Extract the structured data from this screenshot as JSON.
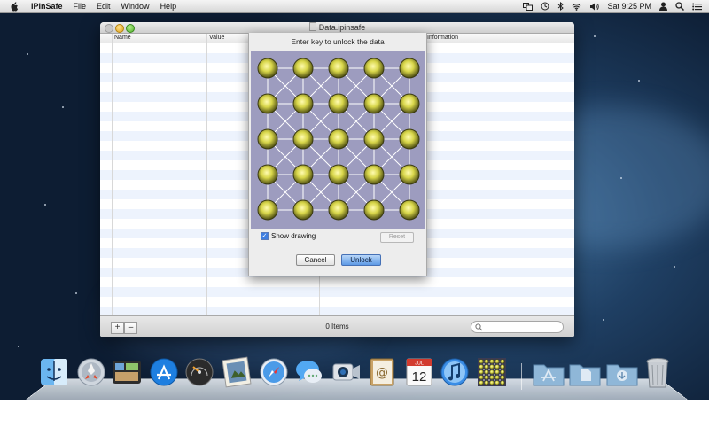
{
  "menubar": {
    "app_name": "iPinSafe",
    "menus": [
      "File",
      "Edit",
      "Window",
      "Help"
    ],
    "clock": "Sat 9:25 PM"
  },
  "window": {
    "title": "Data.ipinsafe",
    "columns": [
      "Name",
      "Value",
      "Information"
    ],
    "items_count": "0 Items",
    "add_label": "+",
    "remove_label": "–"
  },
  "sheet": {
    "title": "Enter key to unlock the data",
    "show_drawing_label": "Show drawing",
    "show_drawing_checked": true,
    "reset_label": "Reset",
    "cancel_label": "Cancel",
    "unlock_label": "Unlock",
    "grid_rows": 5,
    "grid_cols": 5,
    "pin_color": "#d8d64a",
    "grid_bg": "#9d9cbf"
  },
  "dock": {
    "apps": [
      "finder-icon",
      "launchpad-icon",
      "mission-control-icon",
      "app-store-icon",
      "dashboard-icon",
      "preview-icon",
      "safari-icon",
      "messages-icon",
      "facetime-icon",
      "contacts-icon",
      "calendar-icon",
      "itunes-icon",
      "ipinsafe-icon"
    ],
    "folders": [
      "applications-folder-icon",
      "documents-folder-icon",
      "downloads-folder-icon",
      "trash-icon"
    ],
    "calendar_day": "12",
    "calendar_month": "JUL"
  }
}
